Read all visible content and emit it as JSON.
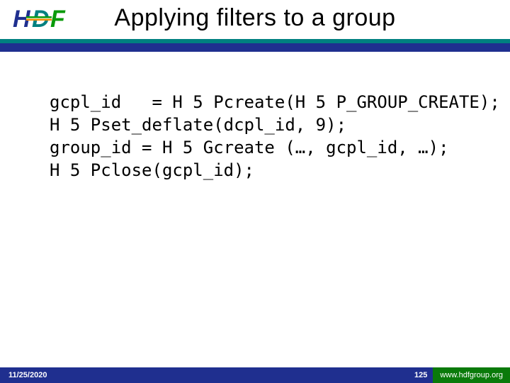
{
  "title": "Applying filters to a group",
  "code": {
    "line1": "gcpl_id   = H 5 Pcreate(H 5 P_GROUP_CREATE);",
    "line2": "H 5 Pset_deflate(dcpl_id, 9);",
    "line3": "group_id = H 5 Gcreate (…, gcpl_id, …);",
    "line4": "H 5 Pclose(gcpl_id);"
  },
  "footer": {
    "date": "11/25/2020",
    "page": "125",
    "url": "www.hdfgroup.org"
  },
  "logo": {
    "text_h": "H",
    "text_d": "D",
    "text_f": "F"
  }
}
